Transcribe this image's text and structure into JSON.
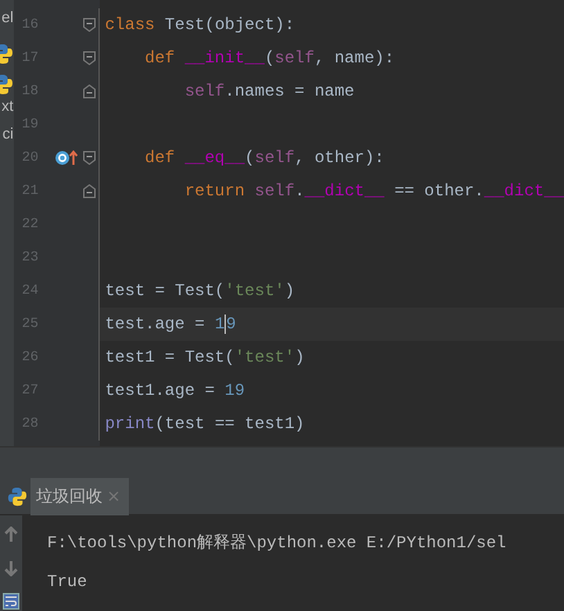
{
  "project_panel": {
    "items": [
      {
        "kind": "text",
        "label": "el"
      },
      {
        "kind": "python"
      },
      {
        "kind": "python"
      },
      {
        "kind": "text",
        "label": "xt"
      },
      {
        "kind": "text",
        "label": "ci"
      }
    ]
  },
  "editor": {
    "lines": [
      {
        "number": "16",
        "current": false,
        "gutter_icons": [
          {
            "kind": "fold_start"
          }
        ],
        "tokens": [
          {
            "kind": "keyword",
            "text": "class"
          },
          {
            "kind": "plain",
            "text": " Test(object):"
          }
        ]
      },
      {
        "number": "17",
        "current": false,
        "gutter_icons": [
          {
            "kind": "fold_start"
          }
        ],
        "tokens": [
          {
            "kind": "keyword",
            "text": "    def "
          },
          {
            "kind": "magic",
            "text": "__init__"
          },
          {
            "kind": "plain",
            "text": "("
          },
          {
            "kind": "self",
            "text": "self"
          },
          {
            "kind": "plain",
            "text": ", name):"
          }
        ]
      },
      {
        "number": "18",
        "current": false,
        "gutter_icons": [
          {
            "kind": "fold_end"
          }
        ],
        "tokens": [
          {
            "kind": "self",
            "text": "        self"
          },
          {
            "kind": "plain",
            "text": ".names = name"
          }
        ]
      },
      {
        "number": "19",
        "current": false
      },
      {
        "number": "20",
        "current": false,
        "gutter_icons": [
          {
            "kind": "override"
          },
          {
            "kind": "fold_start"
          }
        ],
        "tokens": [
          {
            "kind": "keyword",
            "text": "    def "
          },
          {
            "kind": "magic",
            "text": "__eq__"
          },
          {
            "kind": "plain",
            "text": "("
          },
          {
            "kind": "self",
            "text": "self"
          },
          {
            "kind": "plain",
            "text": ", other):"
          }
        ]
      },
      {
        "number": "21",
        "current": false,
        "gutter_icons": [
          {
            "kind": "fold_end"
          }
        ],
        "tokens": [
          {
            "kind": "keyword",
            "text": "        return "
          },
          {
            "kind": "self",
            "text": "self"
          },
          {
            "kind": "plain",
            "text": "."
          },
          {
            "kind": "magic",
            "text": "__dict__"
          },
          {
            "kind": "plain",
            "text": " == other."
          },
          {
            "kind": "magic",
            "text": "__dict__"
          }
        ]
      },
      {
        "number": "22",
        "current": false
      },
      {
        "number": "23",
        "current": false
      },
      {
        "number": "24",
        "current": false,
        "tokens": [
          {
            "kind": "plain",
            "text": "test = Test("
          },
          {
            "kind": "string",
            "text": "'test'"
          },
          {
            "kind": "plain",
            "text": ")"
          }
        ]
      },
      {
        "number": "25",
        "current": true,
        "tokens": [
          {
            "kind": "plain",
            "text": "test.age = "
          },
          {
            "kind": "number",
            "text": "19"
          }
        ]
      },
      {
        "number": "26",
        "current": false,
        "tokens": [
          {
            "kind": "plain",
            "text": "test1 = Test("
          },
          {
            "kind": "string",
            "text": "'test'"
          },
          {
            "kind": "plain",
            "text": ")"
          }
        ]
      },
      {
        "number": "27",
        "current": false,
        "tokens": [
          {
            "kind": "plain",
            "text": "test1.age = "
          },
          {
            "kind": "number",
            "text": "19"
          }
        ]
      },
      {
        "number": "28",
        "current": false,
        "tokens": [
          {
            "kind": "builtin",
            "text": "print"
          },
          {
            "kind": "plain",
            "text": "(test == test1)"
          }
        ]
      }
    ]
  },
  "run_panel": {
    "tab": {
      "label": "垃圾回收",
      "close": "×"
    },
    "output": [
      "F:\\tools\\python解释器\\python.exe E:/PYthon1/sel",
      "True"
    ]
  }
}
